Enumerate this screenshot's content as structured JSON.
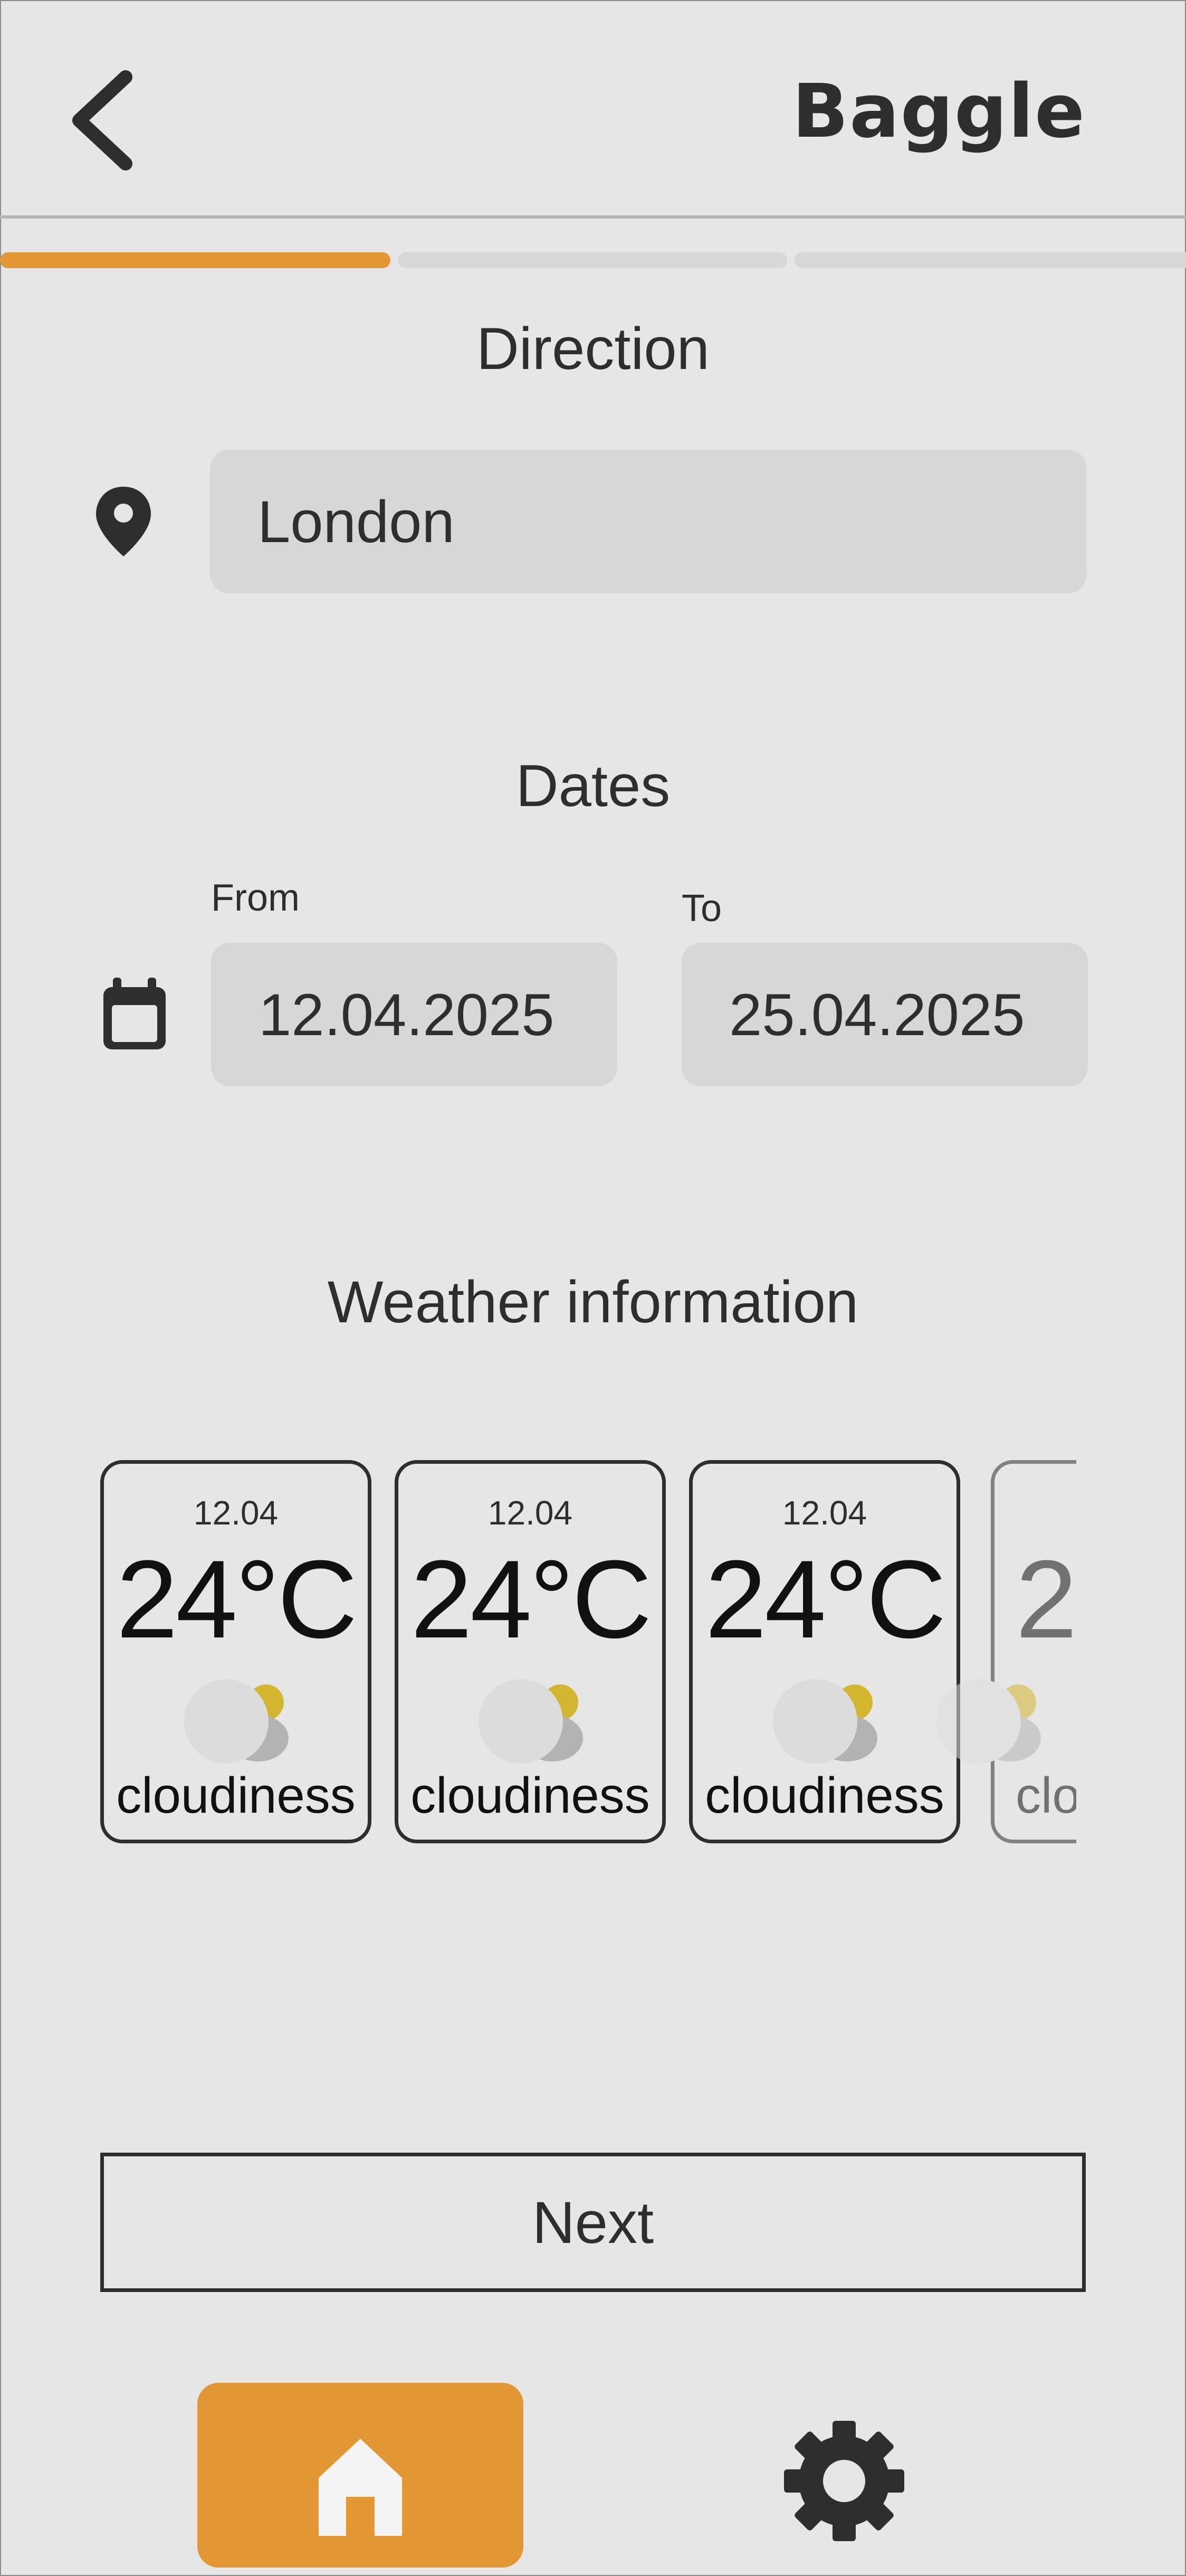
{
  "header": {
    "back_icon": "chevron-left-icon",
    "logo_text": "Baggle"
  },
  "progress": {
    "current_step": 1,
    "total_steps": 3,
    "accent": "#e39734"
  },
  "direction": {
    "title": "Direction",
    "icon": "map-pin-icon",
    "location_value": "London"
  },
  "dates": {
    "title": "Dates",
    "icon": "calendar-icon",
    "from_label": "From",
    "from_value": "12.04.2025",
    "to_label": "To",
    "to_value": "25.04.2025"
  },
  "weather": {
    "title": "Weather information",
    "cards": [
      {
        "date": "12.04",
        "temp": "24°C",
        "icon": "partly-cloudy-icon",
        "desc": "cloudiness"
      },
      {
        "date": "12.04",
        "temp": "24°C",
        "icon": "partly-cloudy-icon",
        "desc": "cloudiness"
      },
      {
        "date": "12.04",
        "temp": "24°C",
        "icon": "partly-cloudy-icon",
        "desc": "cloudiness"
      },
      {
        "date": "",
        "temp": "2",
        "icon": "partly-cloudy-icon",
        "desc": "clo"
      }
    ]
  },
  "actions": {
    "next_label": "Next"
  },
  "nav": {
    "home_icon": "home-icon",
    "settings_icon": "gear-icon"
  },
  "colors": {
    "accent": "#e39734",
    "background": "#e6e6e6",
    "field": "#d8d7d8",
    "text": "#2e2e2e"
  }
}
